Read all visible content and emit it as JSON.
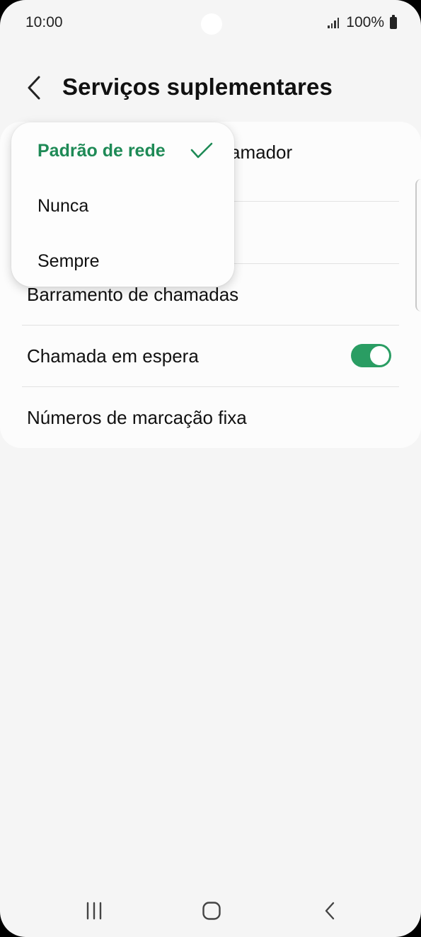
{
  "status_bar": {
    "time": "10:00",
    "battery": "100%",
    "icons": [
      "signal-icon",
      "battery-icon"
    ]
  },
  "header": {
    "back_icon": "chevron-left-icon",
    "title": "Serviços suplementares"
  },
  "settings": {
    "items": [
      {
        "label": "amador"
      },
      {
        "label": ""
      },
      {
        "label": "Barramento de chamadas"
      },
      {
        "label": "Chamada em espera",
        "toggle": true
      },
      {
        "label": "Números de marcação fixa"
      }
    ]
  },
  "popup": {
    "options": [
      {
        "label": "Padrão de rede",
        "selected": true
      },
      {
        "label": "Nunca",
        "selected": false
      },
      {
        "label": "Sempre",
        "selected": false
      }
    ],
    "selected_icon": "check-icon"
  },
  "nav_bar": {
    "icons": [
      "recent-apps-icon",
      "home-icon",
      "back-icon"
    ]
  },
  "colors": {
    "accent": "#1e8a56",
    "toggle_on": "#2a9d63",
    "background": "#f5f5f5",
    "card": "#fcfcfc"
  }
}
